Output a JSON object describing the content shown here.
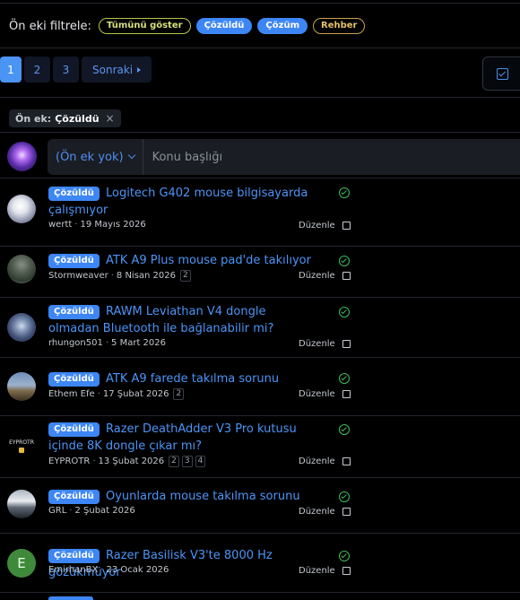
{
  "filters": {
    "label": "Ön eki filtrele:",
    "chips": [
      {
        "label": "Tümünü göster",
        "style": "outline-green"
      },
      {
        "label": "Çözüldü",
        "style": "blue"
      },
      {
        "label": "Çözüm",
        "style": "blue"
      },
      {
        "label": "Rehber",
        "style": "outline-yellow"
      }
    ]
  },
  "pagination": {
    "pages": [
      "1",
      "2",
      "3"
    ],
    "current": "1",
    "next_label": "Sonraki"
  },
  "active_filter": {
    "key": "Ön ek:",
    "value": "Çözüldü",
    "remove": "×"
  },
  "composer": {
    "prefix_value": "(Ön ek yok)",
    "title_placeholder": "Konu başlığı"
  },
  "colors": {
    "accent": "#3d86f5",
    "link": "#4b95f7",
    "solved_check": "#3fbf5a",
    "background": "#000000"
  },
  "threads": [
    {
      "badge": "Çözüldü",
      "title": "Logitech G402 mouse bilgisayarda çalışmıyor",
      "author": "wertt",
      "date": "19 Mayıs 2026",
      "pages": [],
      "edit_label": "Düzenle",
      "avatar": "photo-white-hair-character"
    },
    {
      "badge": "Çözüldü",
      "title": "ATK A9 Plus mouse pad'de takılıyor",
      "author": "Stormweaver",
      "date": "8 Nisan 2026",
      "pages": [
        "2"
      ],
      "edit_label": "Düzenle",
      "avatar": "photo-soldier"
    },
    {
      "badge": "Çözüldü",
      "title": "RAWM Leviathan V4 dongle olmadan Bluetooth ile bağlanabilir mi?",
      "author": "rhungon501",
      "date": "5 Mart 2026",
      "pages": [],
      "edit_label": "Düzenle",
      "avatar": "photo-anime-character"
    },
    {
      "badge": "Çözüldü",
      "title": "ATK A9 farede takılma sorunu",
      "author": "Ethem Efe",
      "date": "17 Şubat 2026",
      "pages": [
        "2"
      ],
      "edit_label": "Düzenle",
      "avatar": "photo-landscape"
    },
    {
      "badge": "Çözüldü",
      "title": "Razer DeathAdder V3 Pro kutusu içinde 8K dongle çıkar mı?",
      "author": "EYPROTR",
      "date": "13 Şubat 2026",
      "pages": [
        "2",
        "3",
        "4"
      ],
      "edit_label": "Düzenle",
      "avatar": "logo-eyprotr",
      "avatar_text": "EYPROTR"
    },
    {
      "badge": "Çözüldü",
      "title": "Oyunlarda mouse takılma sorunu",
      "author": "GRL",
      "date": "2 Şubat 2026",
      "pages": [],
      "edit_label": "Düzenle",
      "avatar": "photo-car"
    },
    {
      "badge": "Çözüldü",
      "title": "Razer Basilisk V3'te 8000 Hz gözükmüyor",
      "author": "EmirhanBX",
      "date": "23 Ocak 2026",
      "pages": [],
      "edit_label": "Düzenle",
      "avatar": "letter-avatar",
      "avatar_text": "E"
    }
  ]
}
